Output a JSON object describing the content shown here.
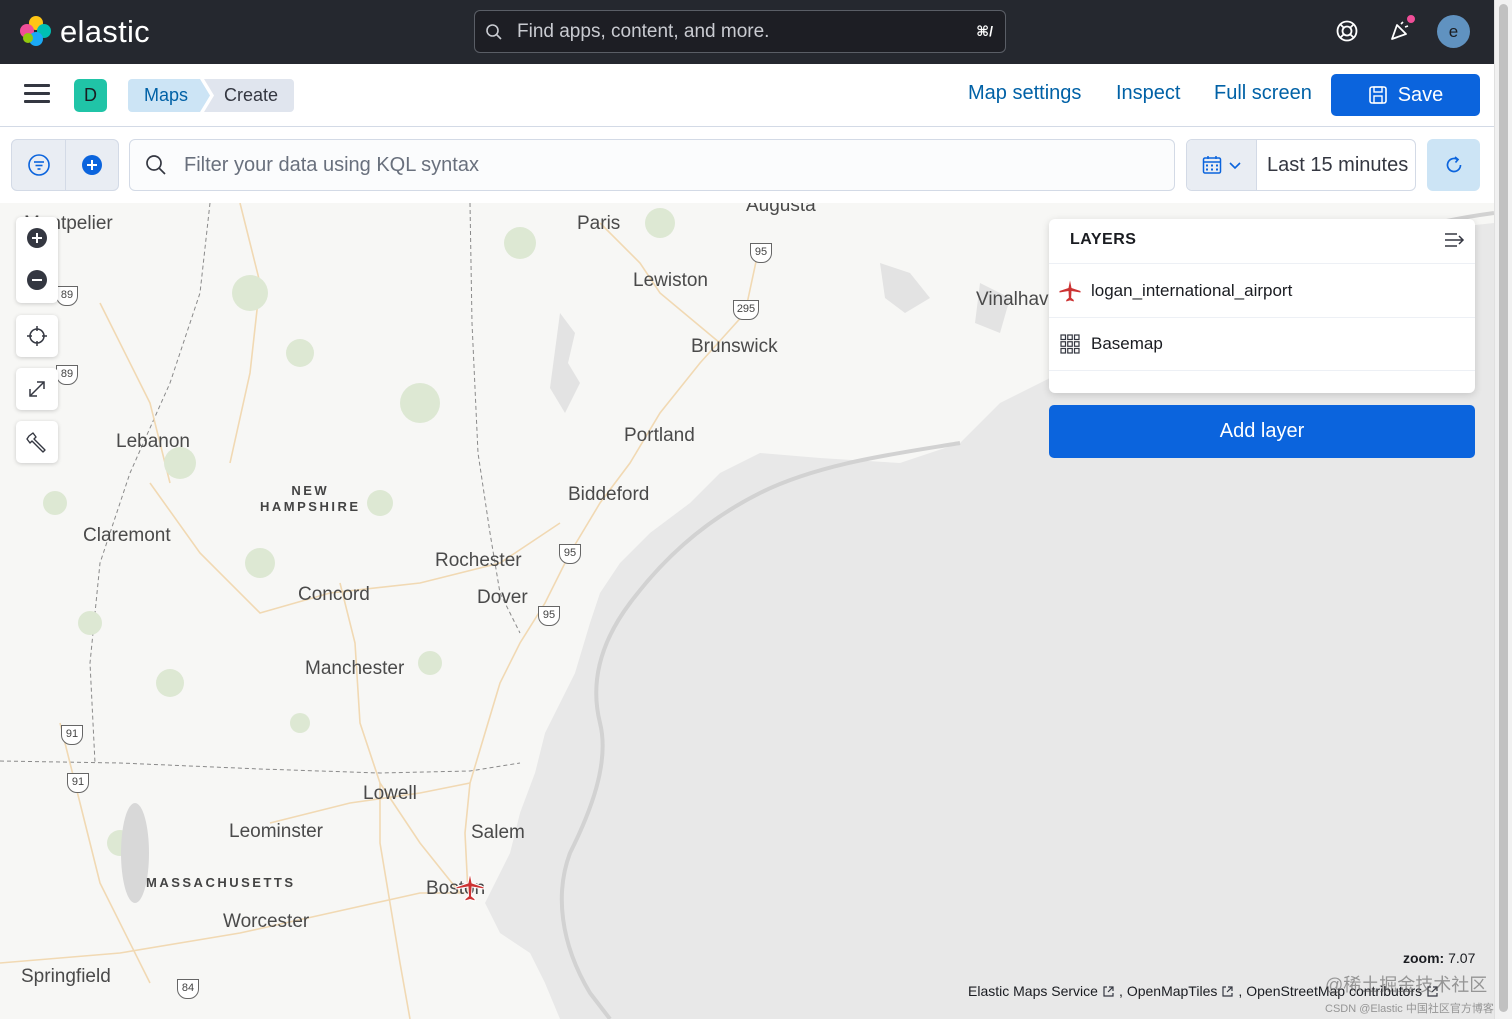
{
  "global_header": {
    "brand": "elastic",
    "search_placeholder": "Find apps, content, and more.",
    "search_shortcut": "⌘/",
    "avatar_initial": "e"
  },
  "app_header": {
    "space_initial": "D",
    "breadcrumbs": [
      "Maps",
      "Create"
    ],
    "links": {
      "map_settings": "Map settings",
      "inspect": "Inspect",
      "full_screen": "Full screen"
    },
    "save_label": "Save"
  },
  "query_bar": {
    "kql_placeholder": "Filter your data using KQL syntax",
    "time_range": "Last 15 minutes"
  },
  "map": {
    "labels": {
      "montpelier": "Montpelier",
      "paris": "Paris",
      "augusta": "Augusta",
      "lewiston": "Lewiston",
      "vinalhaven": "Vinalhaven",
      "brunswick": "Brunswick",
      "lebanon": "Lebanon",
      "portland": "Portland",
      "biddeford": "Biddeford",
      "claremont": "Claremont",
      "rochester": "Rochester",
      "concord": "Concord",
      "dover": "Dover",
      "manchester": "Manchester",
      "lowell": "Lowell",
      "leominster": "Leominster",
      "salem": "Salem",
      "boston": "Boston",
      "worcester": "Worcester",
      "springfield": "Springfield"
    },
    "regions": {
      "new_hampshire": "NEW\nHAMPSHIRE",
      "massachusetts": "MASSACHUSETTS"
    },
    "shields": [
      "95",
      "295",
      "89",
      "89",
      "95",
      "95",
      "91",
      "91",
      "84"
    ],
    "zoom_label": "zoom:",
    "zoom_value": "7.07",
    "attribution": [
      "Elastic Maps Service",
      "OpenMapTiles",
      "OpenStreetMap contributors"
    ]
  },
  "layers_panel": {
    "title": "LAYERS",
    "layers": [
      {
        "name": "logan_international_airport",
        "icon": "airplane-icon"
      },
      {
        "name": "Basemap",
        "icon": "grid-icon"
      }
    ],
    "add_layer_label": "Add layer"
  },
  "watermark": {
    "line1": "@稀土掘金技术社区",
    "line2": "CSDN @Elastic 中国社区官方博客"
  },
  "colors": {
    "header_bg": "#25282f",
    "primary": "#0b64dd",
    "link": "#0061a6",
    "marker": "#cc3333",
    "water": "#e8e8e8"
  }
}
